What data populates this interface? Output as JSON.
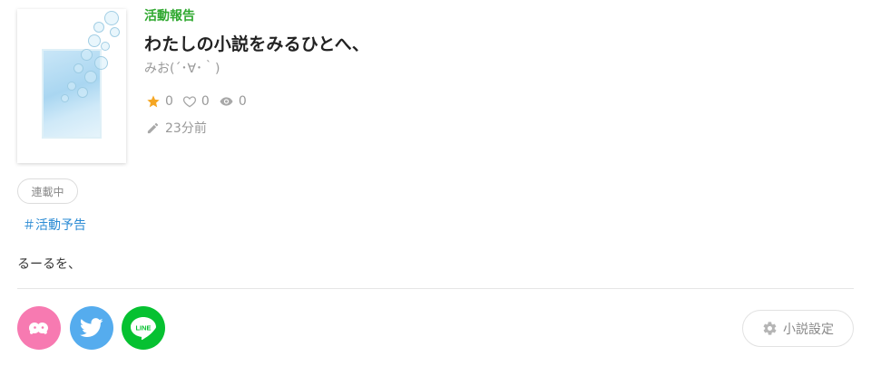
{
  "novel": {
    "genre": "活動報告",
    "title": "わたしの小説をみるひとへ、",
    "author": "みお(´･∀･｀)",
    "stats": {
      "stars": "0",
      "likes": "0",
      "views": "0"
    },
    "updated": "23分前",
    "status": "連載中",
    "tag": "＃活動予告",
    "description": "るーるを、"
  },
  "share": {
    "line_label": "LINE"
  },
  "actions": {
    "settings_label": "小説設定"
  },
  "colors": {
    "genre": "#2fa82f",
    "tag": "#2b8bd4",
    "star": "#f5a623",
    "prism_share": "#f77ab1",
    "twitter_share": "#55acee",
    "line_share": "#06c131"
  },
  "icons": {
    "star": "star-icon",
    "like": "heart-icon",
    "view": "eye-icon",
    "updated": "pencil-icon",
    "settings": "gear-icon"
  }
}
